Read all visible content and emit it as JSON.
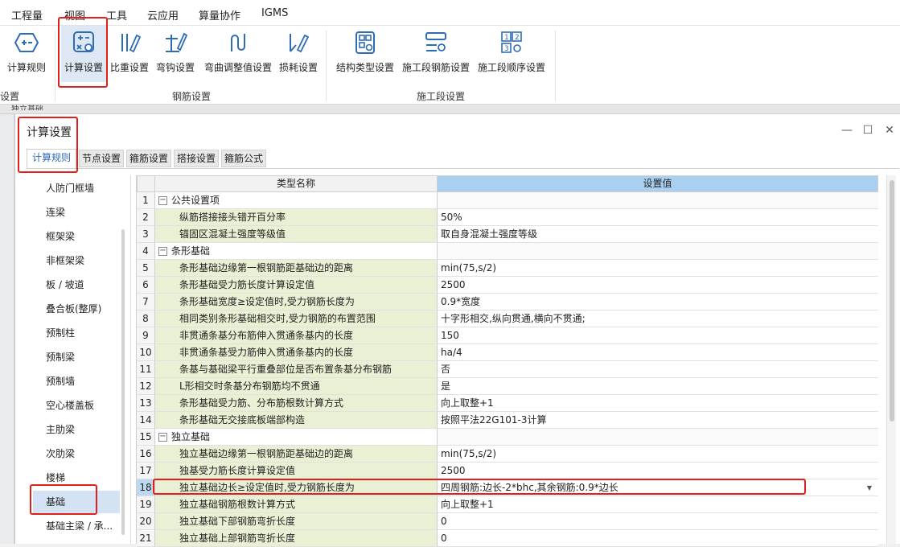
{
  "menu": [
    "工程量",
    "视图",
    "工具",
    "云应用",
    "算量协作",
    "IGMS"
  ],
  "ribbon": {
    "buttons": [
      {
        "label": "计算规则",
        "icon": "hexagon-plus-icon"
      },
      {
        "label": "计算设置",
        "icon": "calc-settings-icon"
      },
      {
        "label": "比重设置",
        "icon": "rebar-weight-icon"
      },
      {
        "label": "弯钩设置",
        "icon": "hook-icon"
      },
      {
        "label": "弯曲调整值设置",
        "icon": "bend-adjust-icon"
      },
      {
        "label": "损耗设置",
        "icon": "loss-icon"
      },
      {
        "label": "结构类型设置",
        "icon": "structure-type-icon"
      },
      {
        "label": "施工段钢筋设置",
        "icon": "segment-rebar-icon"
      },
      {
        "label": "施工段顺序设置",
        "icon": "segment-order-icon"
      }
    ],
    "groups": [
      "置设置",
      "钢筋设置",
      "施工段设置"
    ]
  },
  "strip_text": "独立基础",
  "dialog": {
    "title": "计算设置",
    "tabs": [
      "计算规则",
      "节点设置",
      "箍筋设置",
      "搭接设置",
      "箍筋公式"
    ],
    "left_items": [
      "人防门框墙",
      "连梁",
      "框架梁",
      "非框架梁",
      "板 / 坡道",
      "叠合板(整厚)",
      "预制柱",
      "预制梁",
      "预制墙",
      "空心楼盖板",
      "主肋梁",
      "次肋梁",
      "楼梯",
      "基础",
      "基础主梁 / 承..."
    ],
    "selected_left": "基础",
    "columns": [
      "类型名称",
      "设置值"
    ],
    "rows": [
      {
        "n": "1",
        "name": "公共设置项",
        "value": "",
        "type": "header"
      },
      {
        "n": "2",
        "name": "纵筋搭接接头错开百分率",
        "value": "50%",
        "type": "item"
      },
      {
        "n": "3",
        "name": "锚固区混凝土强度等级值",
        "value": "取自身混凝土强度等级",
        "type": "item"
      },
      {
        "n": "4",
        "name": "条形基础",
        "value": "",
        "type": "header"
      },
      {
        "n": "5",
        "name": "条形基础边缘第一根钢筋距基础边的距离",
        "value": "min(75,s/2)",
        "type": "item"
      },
      {
        "n": "6",
        "name": "条形基础受力筋长度计算设定值",
        "value": "2500",
        "type": "item"
      },
      {
        "n": "7",
        "name": "条形基础宽度≥设定值时,受力钢筋长度为",
        "value": "0.9*宽度",
        "type": "item"
      },
      {
        "n": "8",
        "name": "相同类别条形基础相交时,受力钢筋的布置范围",
        "value": "十字形相交,纵向贯通,横向不贯通;",
        "type": "item"
      },
      {
        "n": "9",
        "name": "非贯通条基分布筋伸入贯通条基内的长度",
        "value": "150",
        "type": "item"
      },
      {
        "n": "10",
        "name": "非贯通条基受力筋伸入贯通条基内的长度",
        "value": "ha/4",
        "type": "item"
      },
      {
        "n": "11",
        "name": "条基与基础梁平行重叠部位是否布置条基分布钢筋",
        "value": "否",
        "type": "item"
      },
      {
        "n": "12",
        "name": "L形相交时条基分布钢筋均不贯通",
        "value": "是",
        "type": "item"
      },
      {
        "n": "13",
        "name": "条形基础受力筋、分布筋根数计算方式",
        "value": "向上取整+1",
        "type": "item"
      },
      {
        "n": "14",
        "name": "条形基础无交接底板端部构造",
        "value": "按照平法22G101-3计算",
        "type": "item"
      },
      {
        "n": "15",
        "name": "独立基础",
        "value": "",
        "type": "header"
      },
      {
        "n": "16",
        "name": "独立基础边缘第一根钢筋距基础边的距离",
        "value": "min(75,s/2)",
        "type": "item"
      },
      {
        "n": "17",
        "name": "独基受力筋长度计算设定值",
        "value": "2500",
        "type": "item"
      },
      {
        "n": "18",
        "name": "独立基础边长≥设定值时,受力钢筋长度为",
        "value": "四周钢筋:边长-2*bhc,其余钢筋:0.9*边长",
        "type": "item",
        "selected": true
      },
      {
        "n": "19",
        "name": "独立基础钢筋根数计算方式",
        "value": "向上取整+1",
        "type": "item"
      },
      {
        "n": "20",
        "name": "独立基础下部钢筋弯折长度",
        "value": "0",
        "type": "item"
      },
      {
        "n": "21",
        "name": "独立基础上部钢筋弯折长度",
        "value": "0",
        "type": "item"
      }
    ]
  }
}
